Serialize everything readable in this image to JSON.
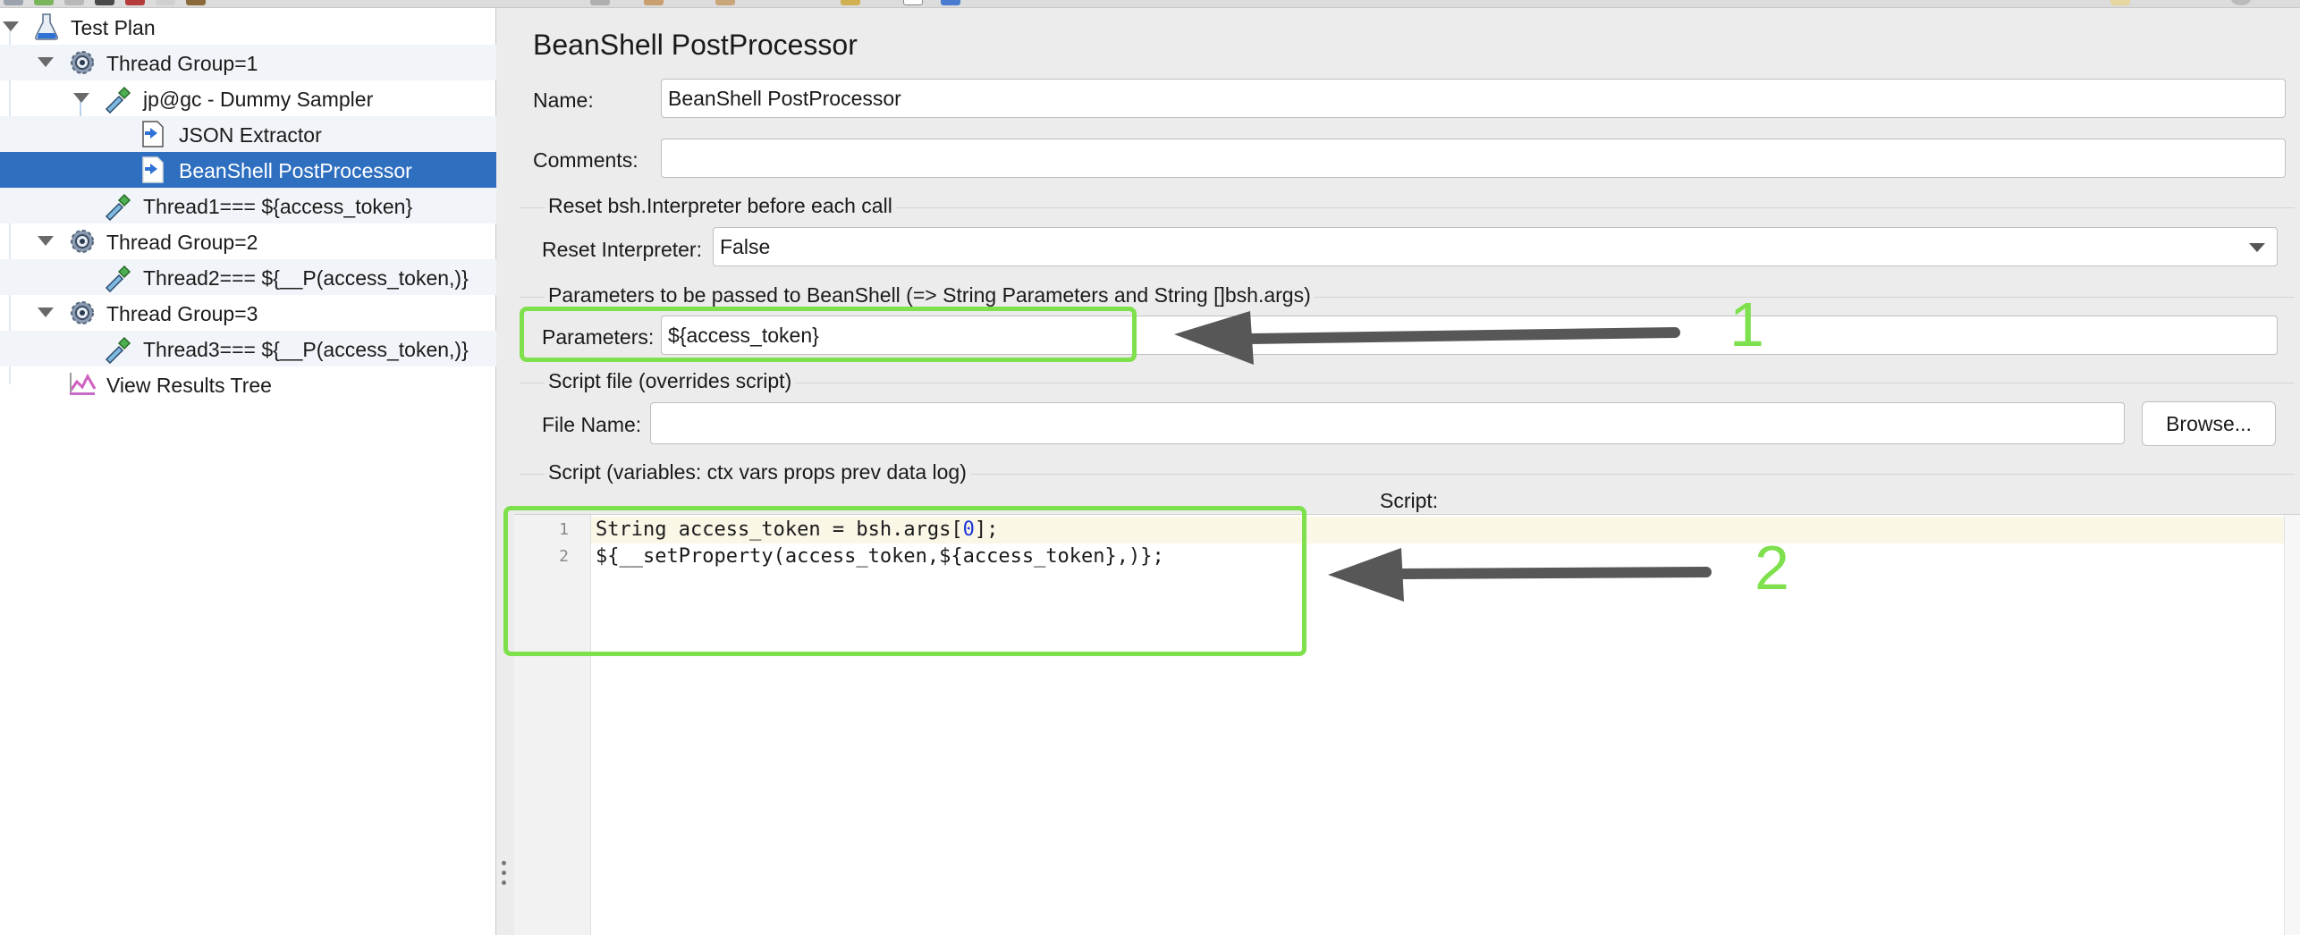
{
  "tree": {
    "items": [
      {
        "label": "Test Plan",
        "icon": "flask-icon"
      },
      {
        "label": "Thread Group=1",
        "icon": "gear-icon"
      },
      {
        "label": "jp@gc - Dummy Sampler",
        "icon": "pipette-icon"
      },
      {
        "label": "JSON Extractor",
        "icon": "document-arrow-icon"
      },
      {
        "label": "BeanShell PostProcessor",
        "icon": "document-arrow-icon"
      },
      {
        "label": "Thread1=== ${access_token}",
        "icon": "pipette-icon"
      },
      {
        "label": "Thread Group=2",
        "icon": "gear-icon"
      },
      {
        "label": "Thread2=== ${__P(access_token,)}",
        "icon": "pipette-icon"
      },
      {
        "label": "Thread Group=3",
        "icon": "gear-icon"
      },
      {
        "label": "Thread3=== ${__P(access_token,)}",
        "icon": "pipette-icon"
      },
      {
        "label": "View Results Tree",
        "icon": "chart-icon"
      }
    ],
    "selected": "BeanShell PostProcessor"
  },
  "panel": {
    "title": "BeanShell PostProcessor",
    "name_label": "Name:",
    "name_value": "BeanShell PostProcessor",
    "comments_label": "Comments:",
    "comments_value": "",
    "reset_section": "Reset bsh.Interpreter before each call",
    "reset_label": "Reset Interpreter:",
    "reset_value": "False",
    "params_section": "Parameters to be passed to BeanShell (=> String Parameters and String []bsh.args)",
    "params_label": "Parameters:",
    "params_value": "${access_token}",
    "file_section": "Script file (overrides script)",
    "file_label": "File Name:",
    "file_value": "",
    "browse_label": "Browse...",
    "script_section": "Script (variables: ctx vars props prev data log)",
    "script_label": "Script:",
    "code": [
      {
        "line_no": "1",
        "pre": "String access_token = bsh.args[",
        "num": "0",
        "post": "];"
      },
      {
        "line_no": "2",
        "pre": "${__setProperty(access_token,${access_token},)};",
        "num": "",
        "post": ""
      }
    ]
  },
  "annotations": {
    "marker1": "1",
    "marker2": "2",
    "color": "#7ee04c",
    "arrow_color": "#575757"
  },
  "colors": {
    "selection": "#2f6fc0",
    "alt_row": "#f1f4f8",
    "panel_bg": "#ececec"
  }
}
